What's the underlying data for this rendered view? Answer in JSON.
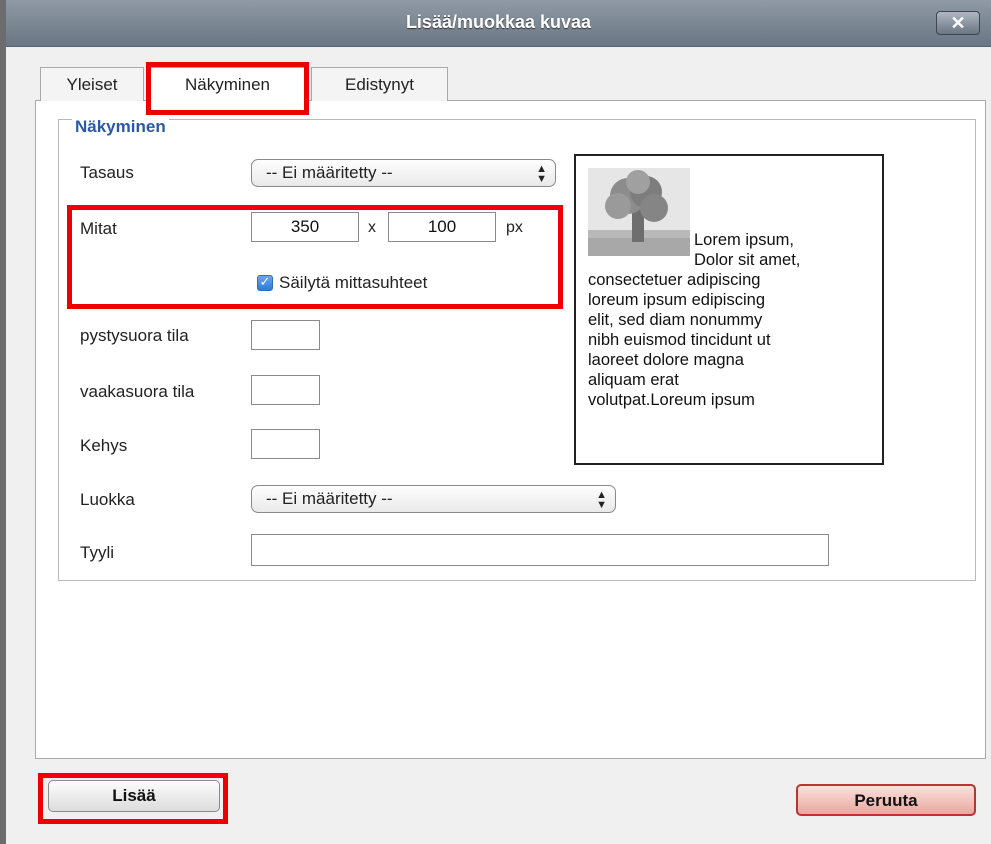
{
  "window": {
    "title": "Lisää/muokkaa kuvaa",
    "close_label": "✕"
  },
  "tabs": [
    {
      "label": "Yleiset"
    },
    {
      "label": "Näkyminen",
      "active": true
    },
    {
      "label": "Edistynyt"
    }
  ],
  "section": {
    "legend": "Näkyminen"
  },
  "form": {
    "tasaus": {
      "label": "Tasaus",
      "value": "-- Ei määritetty --"
    },
    "mitat": {
      "label": "Mitat",
      "width": "350",
      "separator": "x",
      "height": "100",
      "unit": "px"
    },
    "keep_ratio": {
      "label": "Säilytä mittasuhteet",
      "checked": true
    },
    "pystysuora": {
      "label": "pystysuora tila",
      "value": ""
    },
    "vaakasuora": {
      "label": "vaakasuora tila",
      "value": ""
    },
    "kehys": {
      "label": "Kehys",
      "value": ""
    },
    "luokka": {
      "label": "Luokka",
      "value": "-- Ei määritetty --"
    },
    "tyyli": {
      "label": "Tyyli",
      "value": ""
    }
  },
  "preview": {
    "icon": "tree-image-icon",
    "lines": [
      "Lorem ipsum,",
      "Dolor sit amet,",
      "consectetuer adipiscing",
      "loreum ipsum edipiscing",
      "elit, sed diam nonummy",
      "nibh euismod tincidunt ut",
      "laoreet dolore magna",
      "aliquam erat",
      "volutpat.Loreum ipsum"
    ]
  },
  "buttons": {
    "insert": "Lisää",
    "cancel": "Peruuta"
  },
  "colors": {
    "highlight": "#e00000",
    "legend": "#2a59a8",
    "cancel_border": "#bb3333"
  }
}
